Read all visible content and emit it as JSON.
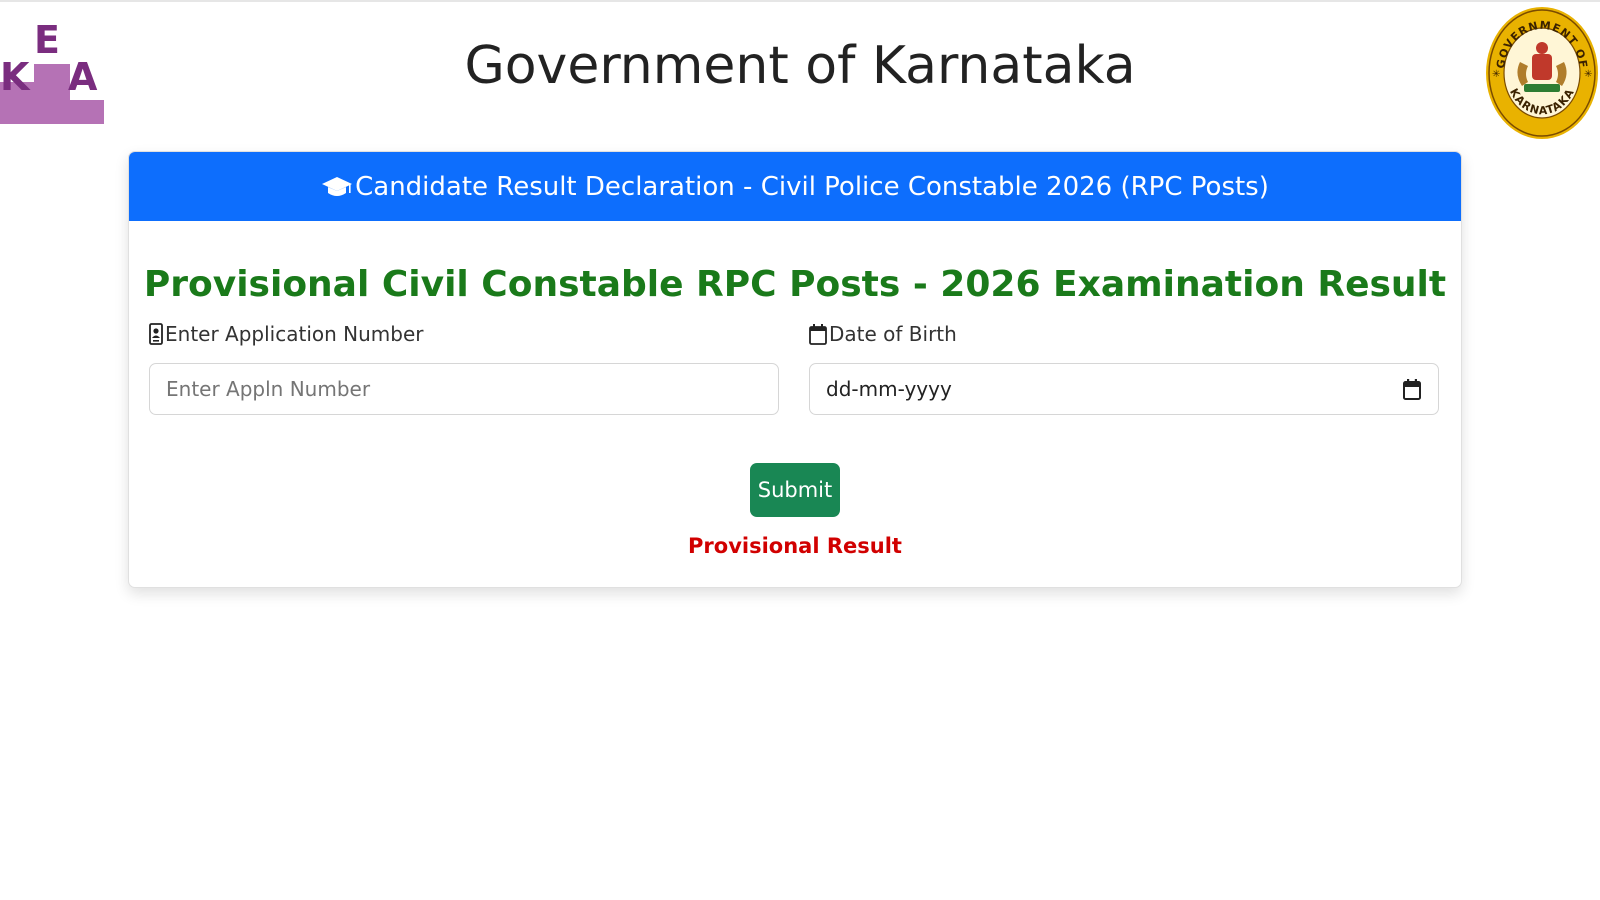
{
  "header": {
    "title": "Government of Karnataka",
    "kea_logo_text": "KEA",
    "seal_text": "GOVERNMENT OF KARNATAKA"
  },
  "card": {
    "header_text": "Candidate Result Declaration - Civil Police Constable 2026 (RPC Posts)",
    "result_title": "Provisional Civil Constable RPC Posts - 2026 Examination Result"
  },
  "form": {
    "application_label": "Enter Application Number",
    "application_placeholder": "Enter Appln Number",
    "application_value": "",
    "dob_label": "Date of Birth",
    "dob_placeholder": "dd-mm-yyyy",
    "submit_label": "Submit",
    "note": "Provisional Result"
  },
  "colors": {
    "header_blue": "#0d6efd",
    "title_green": "#1a7a1a",
    "submit_green": "#198754",
    "note_red": "#d10000",
    "kea_purple": "#7a2d7f"
  },
  "icons": {
    "card_header": "graduation-cap-icon",
    "application_label": "id-badge-icon",
    "dob_label": "calendar-icon",
    "dob_picker": "calendar-icon"
  }
}
